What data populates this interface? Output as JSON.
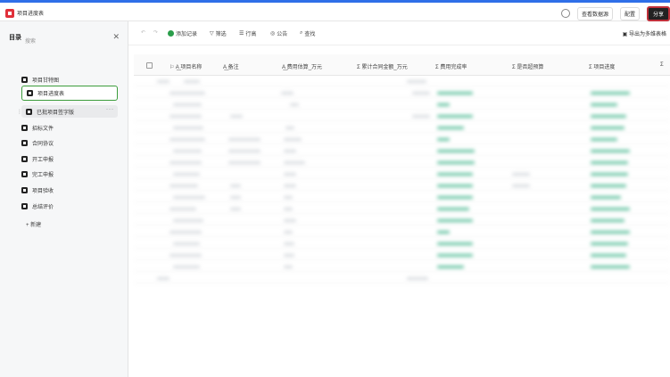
{
  "window": {
    "title": "项目进度表"
  },
  "topbar": {
    "buttons": [
      "查看数据源",
      "配置",
      "分享"
    ]
  },
  "sidebar": {
    "title": "目录",
    "search_placeholder": "搜索",
    "items": [
      {
        "label": "项目甘特图"
      },
      {
        "label": "项目进度表"
      },
      {
        "label": "已批项目签字版"
      },
      {
        "label": "招标文件"
      },
      {
        "label": "合同协议"
      },
      {
        "label": "开工申报"
      },
      {
        "label": "完工申报"
      },
      {
        "label": "项目验收"
      },
      {
        "label": "总结评价"
      }
    ],
    "new_label": "+ 新建"
  },
  "toolbar": {
    "add_label": "添加记录",
    "filter_label": "筛选",
    "rowheight_label": "行高",
    "announce_label": "公告",
    "search_label": "查找",
    "export_label": "导出为多维表格"
  },
  "table": {
    "columns": [
      "项目名称",
      "备注",
      "费用估算_万元",
      "累计合同金额_万元",
      "费用完成率",
      "是否超预算",
      "项目进度",
      "Σ"
    ]
  },
  "colors": {
    "accent": "#2f6fe8",
    "active_border": "#3c9d3c",
    "bar_green": "#3fb48a",
    "brand_red": "#e0303a"
  }
}
